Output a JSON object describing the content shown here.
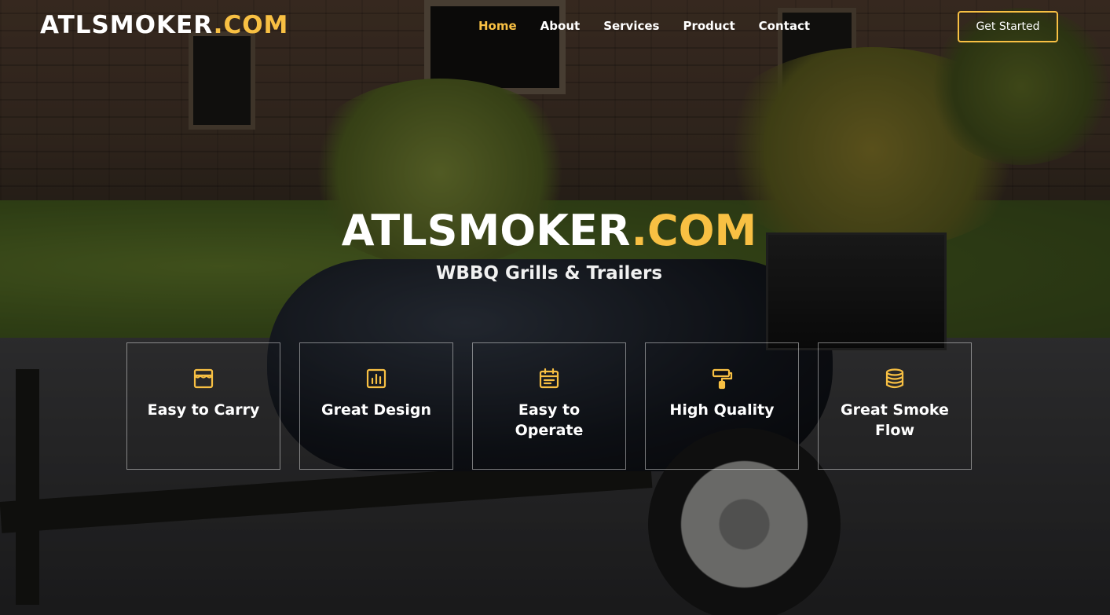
{
  "header": {
    "logo_main": "ATLSMOKER",
    "logo_accent": ".COM",
    "nav": [
      {
        "label": "Home",
        "active": true
      },
      {
        "label": "About",
        "active": false
      },
      {
        "label": "Services",
        "active": false
      },
      {
        "label": "Product",
        "active": false
      },
      {
        "label": "Contact",
        "active": false
      }
    ],
    "cta_label": "Get Started"
  },
  "hero": {
    "title_main": "ATLSMOKER",
    "title_accent": ".COM",
    "subtitle": "WBBQ Grills & Trailers"
  },
  "features": [
    {
      "label": "Easy to Carry",
      "icon": "store-icon"
    },
    {
      "label": "Great Design",
      "icon": "bar-chart-icon"
    },
    {
      "label": "Easy to Operate",
      "icon": "calendar-icon"
    },
    {
      "label": "High Quality",
      "icon": "paint-roller-icon"
    },
    {
      "label": "Great Smoke Flow",
      "icon": "database-icon"
    }
  ],
  "colors": {
    "accent": "#f8c043",
    "text": "#ffffff"
  }
}
